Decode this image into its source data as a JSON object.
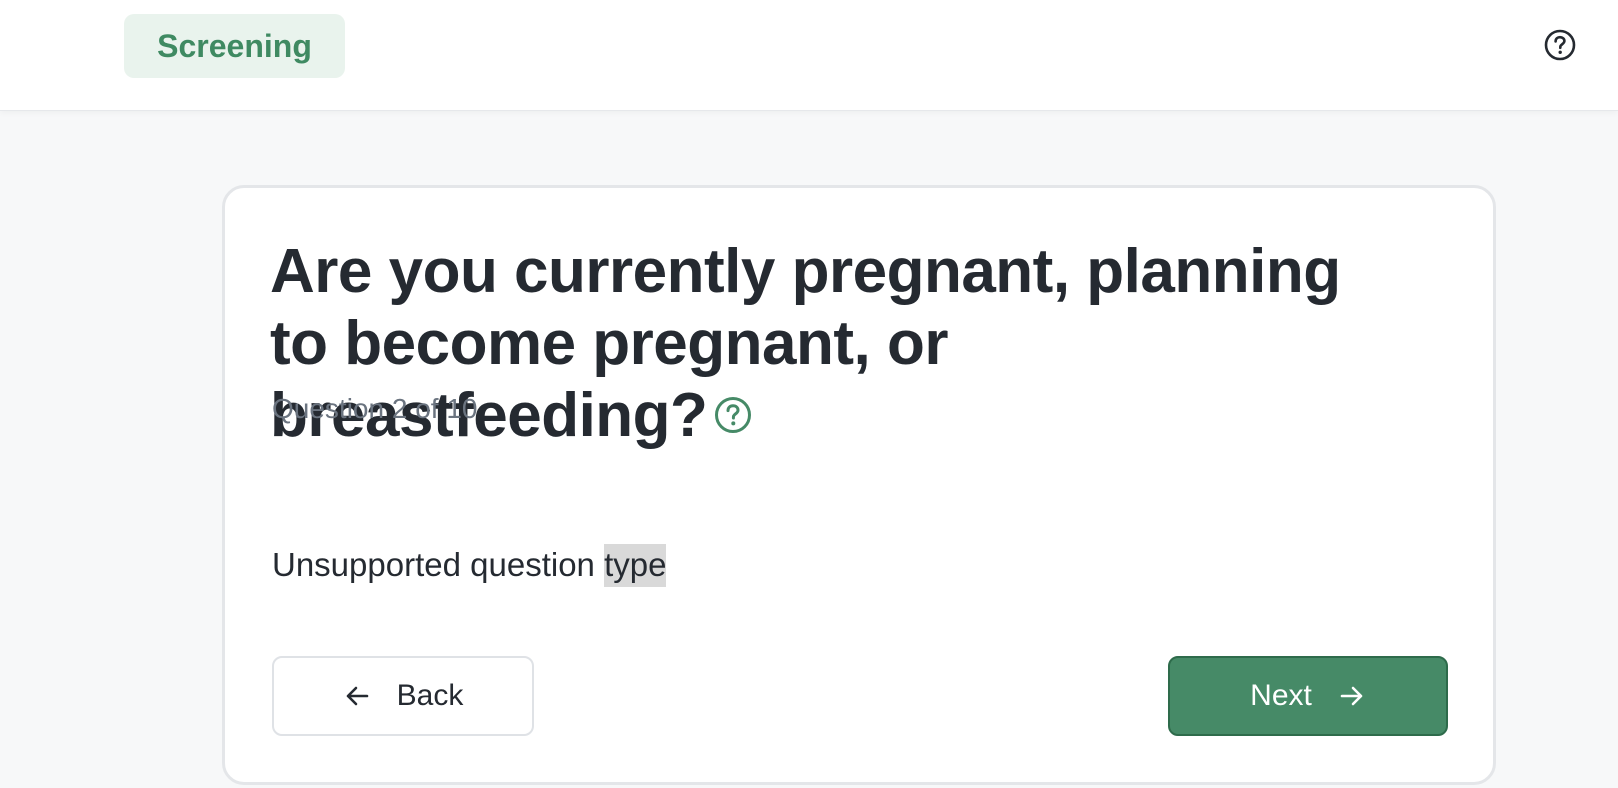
{
  "header": {
    "stage_label": "Screening",
    "help_icon": "question-circle-icon"
  },
  "question": {
    "title": "Are you currently pregnant, planning to become pregnant, or breastfeeding?",
    "help_icon": "question-circle-icon",
    "progress_text": "Question 2 of 10",
    "current": 2,
    "total": 10
  },
  "body": {
    "message_prefix": "Unsupported question ",
    "message_highlighted": "type"
  },
  "actions": {
    "back_label": "Back",
    "back_icon": "arrow-left-icon",
    "next_label": "Next",
    "next_icon": "arrow-right-icon"
  },
  "colors": {
    "brand_green": "#468a67",
    "pill_bg": "#e9f3ed",
    "pill_text": "#3f8a62",
    "text_primary": "#252a31",
    "text_muted": "#6b7480",
    "page_bg": "#f7f8f9"
  }
}
